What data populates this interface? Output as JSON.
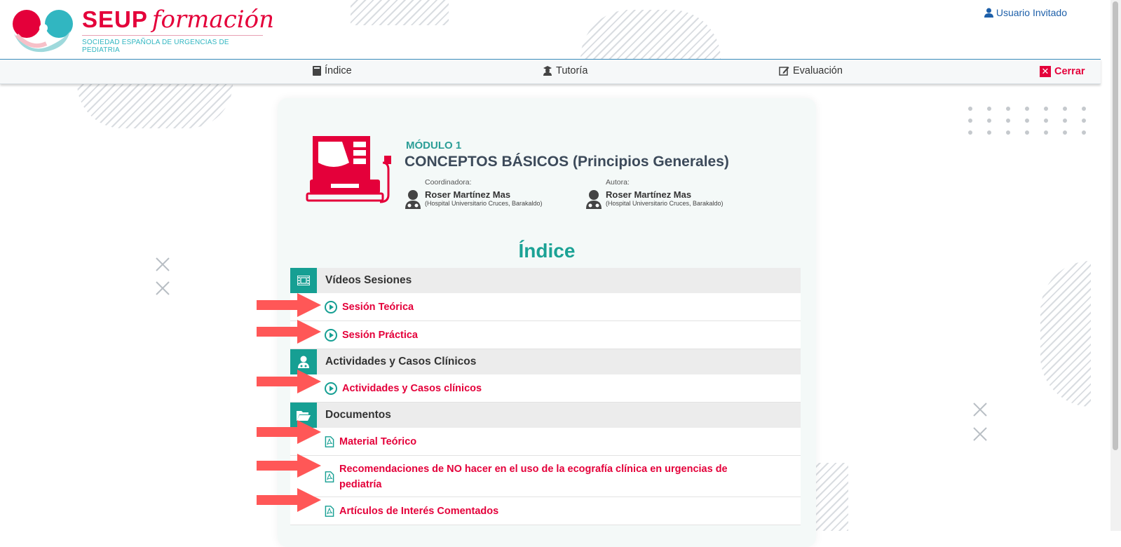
{
  "brand": {
    "title": "SEUP",
    "script": "formación",
    "subtitle": "SOCIEDAD ESPAÑOLA DE URGENCIAS DE PEDIATRIA",
    "primary_color": "#e4003a",
    "accent_color": "#31b6c1"
  },
  "header": {
    "user_label": "Usuario Invitado"
  },
  "nav": {
    "index_label": "Índice",
    "tutoria_label": "Tutoría",
    "evaluacion_label": "Evaluación",
    "close_label": "Cerrar"
  },
  "module": {
    "label": "MÓDULO 1",
    "title": "CONCEPTOS BÁSICOS (Principios Generales)",
    "coordinator": {
      "role": "Coordinadora:",
      "name": "Roser Martínez Mas",
      "institution": "(Hospital Universitario Cruces, Barakaldo)"
    },
    "author": {
      "role": "Autora:",
      "name": "Roser Martínez Mas",
      "institution": "(Hospital Universitario Cruces, Barakaldo)"
    }
  },
  "index_heading": "Índice",
  "sections": [
    {
      "title": "Vídeos Sesiones",
      "icon": "film-icon",
      "items": [
        {
          "label": "Sesión Teórica",
          "icon": "play-circle-icon"
        },
        {
          "label": "Sesión Práctica",
          "icon": "play-circle-icon"
        }
      ]
    },
    {
      "title": "Actividades y Casos Clínicos",
      "icon": "doctor-icon",
      "items": [
        {
          "label": "Actividades y Casos clínicos",
          "icon": "play-circle-icon"
        }
      ]
    },
    {
      "title": "Documentos",
      "icon": "folder-open-icon",
      "items": [
        {
          "label": "Material Teórico",
          "icon": "pdf-icon"
        },
        {
          "label": "Recomendaciones de NO hacer en el uso de la ecografía clínica en urgencias de pediatría",
          "icon": "pdf-icon"
        },
        {
          "label": "Artículos de Interés Comentados",
          "icon": "pdf-icon"
        }
      ]
    }
  ]
}
